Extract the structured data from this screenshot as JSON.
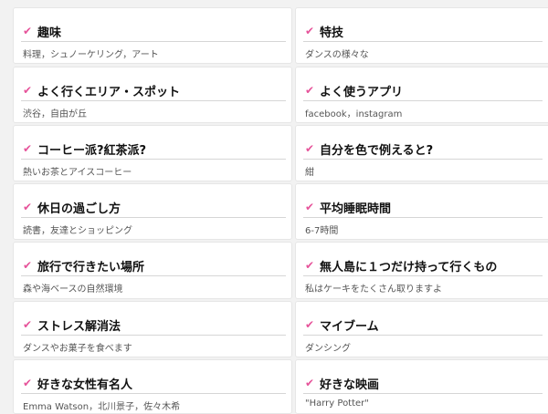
{
  "profile_items": [
    {
      "title": "趣味",
      "value": "料理，シュノーケリング，アート"
    },
    {
      "title": "特技",
      "value": "ダンスの様々な"
    },
    {
      "title": "よく行くエリア・スポット",
      "value": "渋谷，自由が丘"
    },
    {
      "title": "よく使うアプリ",
      "value": "facebook，instagram"
    },
    {
      "title": "コーヒー派?紅茶派?",
      "value": "熱いお茶とアイスコーヒー"
    },
    {
      "title": "自分を色で例えると?",
      "value": "紺"
    },
    {
      "title": "休日の過ごし方",
      "value": "読書，友達とショッピング"
    },
    {
      "title": "平均睡眠時間",
      "value": "6-7時間"
    },
    {
      "title": "旅行で行きたい場所",
      "value": "森や海ベースの自然環境"
    },
    {
      "title": "無人島に１つだけ持って行くもの",
      "value": "私はケーキをたくさん取りますよ"
    },
    {
      "title": "ストレス解消法",
      "value": "ダンスやお菓子を食べます"
    },
    {
      "title": "マイブーム",
      "value": "ダンシング"
    },
    {
      "title": "好きな女性有名人",
      "value": "Emma Watson，北川景子，佐々木希"
    },
    {
      "title": "好きな映画",
      "value": "\"Harry Potter\""
    }
  ],
  "check_icon": "check-icon",
  "accent_color": "#e6539a"
}
